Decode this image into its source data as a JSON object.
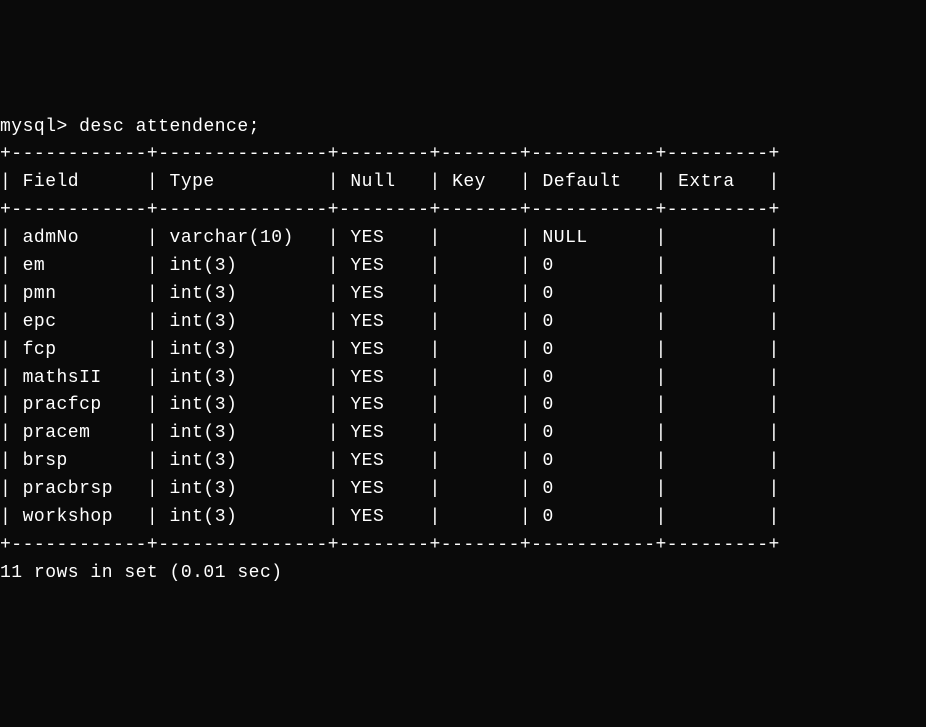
{
  "prompt": "mysql>",
  "command": "desc attendence;",
  "headers": {
    "field": "Field",
    "type": "Type",
    "null": "Null",
    "key": "Key",
    "default": "Default",
    "extra": "Extra"
  },
  "rows": [
    {
      "field": "admNo",
      "type": "varchar(10)",
      "null": "YES",
      "key": "",
      "default": "NULL",
      "extra": ""
    },
    {
      "field": "em",
      "type": "int(3)",
      "null": "YES",
      "key": "",
      "default": "0",
      "extra": ""
    },
    {
      "field": "pmn",
      "type": "int(3)",
      "null": "YES",
      "key": "",
      "default": "0",
      "extra": ""
    },
    {
      "field": "epc",
      "type": "int(3)",
      "null": "YES",
      "key": "",
      "default": "0",
      "extra": ""
    },
    {
      "field": "fcp",
      "type": "int(3)",
      "null": "YES",
      "key": "",
      "default": "0",
      "extra": ""
    },
    {
      "field": "mathsII",
      "type": "int(3)",
      "null": "YES",
      "key": "",
      "default": "0",
      "extra": ""
    },
    {
      "field": "pracfcp",
      "type": "int(3)",
      "null": "YES",
      "key": "",
      "default": "0",
      "extra": ""
    },
    {
      "field": "pracem",
      "type": "int(3)",
      "null": "YES",
      "key": "",
      "default": "0",
      "extra": ""
    },
    {
      "field": "brsp",
      "type": "int(3)",
      "null": "YES",
      "key": "",
      "default": "0",
      "extra": ""
    },
    {
      "field": "pracbrsp",
      "type": "int(3)",
      "null": "YES",
      "key": "",
      "default": "0",
      "extra": ""
    },
    {
      "field": "workshop",
      "type": "int(3)",
      "null": "YES",
      "key": "",
      "default": "0",
      "extra": ""
    }
  ],
  "footer": "11 rows in set (0.01 sec)",
  "widths": {
    "field": 10,
    "type": 13,
    "null": 6,
    "key": 5,
    "default": 9,
    "extra": 7
  }
}
